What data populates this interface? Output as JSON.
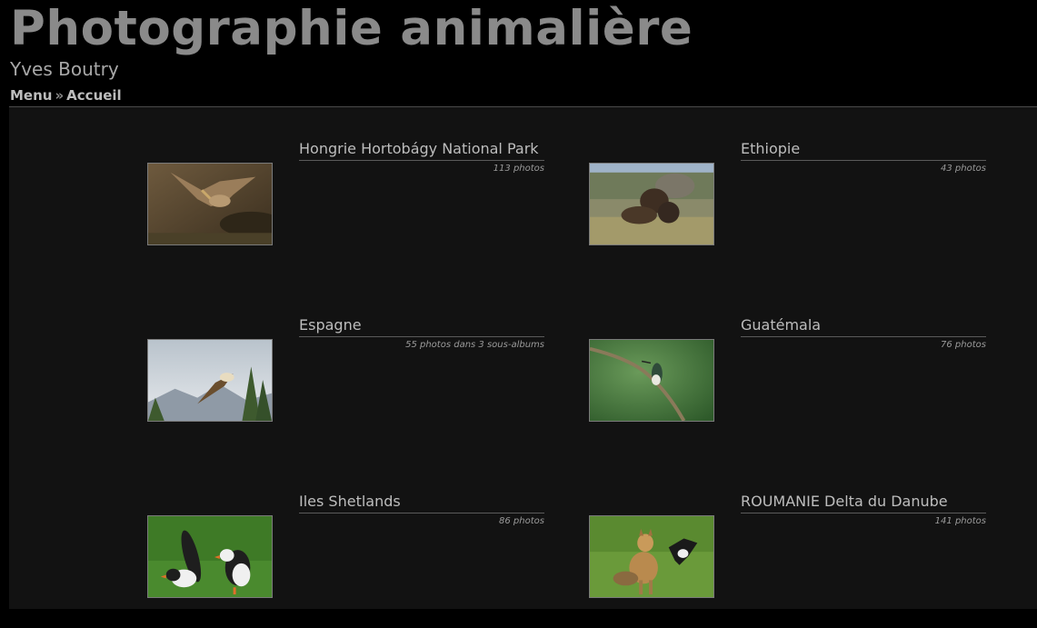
{
  "site": {
    "title": "Photographie animalière",
    "subtitle": "Yves Boutry"
  },
  "breadcrumb": {
    "menu": "Menu",
    "separator": "»",
    "current": "Accueil"
  },
  "albums": [
    {
      "title": "Hongrie Hortobágy National Park",
      "count": "113 photos",
      "thumb_icon": "sparrowhawk-photo"
    },
    {
      "title": "Ethiopie",
      "count": "43 photos",
      "thumb_icon": "gelada-monkeys-photo"
    },
    {
      "title": "Espagne",
      "count": "55 photos dans 3 sous-albums",
      "thumb_icon": "vulture-in-flight-photo"
    },
    {
      "title": "Guatémala",
      "count": "76 photos",
      "thumb_icon": "hummingbird-photo"
    },
    {
      "title": "Iles Shetlands",
      "count": "86 photos",
      "thumb_icon": "puffins-photo"
    },
    {
      "title": "ROUMANIE Delta du Danube",
      "count": "141 photos",
      "thumb_icon": "jackal-and-magpie-photo"
    }
  ]
}
